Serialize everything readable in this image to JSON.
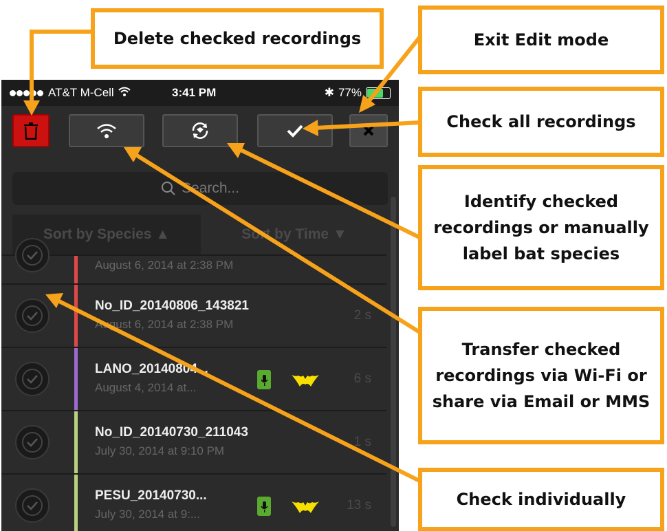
{
  "status_bar": {
    "carrier": "AT&T M-Cell",
    "time": "3:41 PM",
    "battery": "77%",
    "battery_level": 0.77
  },
  "toolbar": {
    "delete_icon": "trash-icon",
    "wifi_icon": "wifi-icon",
    "identify_icon": "identify-icon",
    "check_icon": "checkmark-icon",
    "exit_icon": "close-icon",
    "delete_color": "#cc1111"
  },
  "search": {
    "placeholder": "Search..."
  },
  "sort": {
    "species": "Sort by Species ▲",
    "time": "Sort by Time ▼"
  },
  "recordings": [
    {
      "name": "",
      "date": "August 6, 2014 at 2:38 PM",
      "duration": "",
      "color": "#e04848"
    },
    {
      "name": "No_ID_20140806_143821",
      "date": "August 6, 2014 at 2:38 PM",
      "duration": "2 s",
      "color": "#e04848"
    },
    {
      "name": "LANO_20140804...",
      "date": "August 4, 2014 at...",
      "duration": "6 s",
      "color": "#9c6ad0"
    },
    {
      "name": "No_ID_20140730_211043",
      "date": "July 30, 2014 at 9:10 PM",
      "duration": "1 s",
      "color": "#b8d080"
    },
    {
      "name": "PESU_20140730...",
      "date": "July 30, 2014 at 9:...",
      "duration": "13 s",
      "color": "#b8d080"
    }
  ],
  "callouts": {
    "delete": "Delete checked recordings",
    "exit": "Exit Edit mode",
    "check_all": "Check all recordings",
    "identify": "Identify checked recordings or manually label bat species",
    "transfer": "Transfer checked recordings via Wi-Fi or share via Email or MMS",
    "check_individually": "Check individually"
  },
  "accent_color": "#f7a21b"
}
